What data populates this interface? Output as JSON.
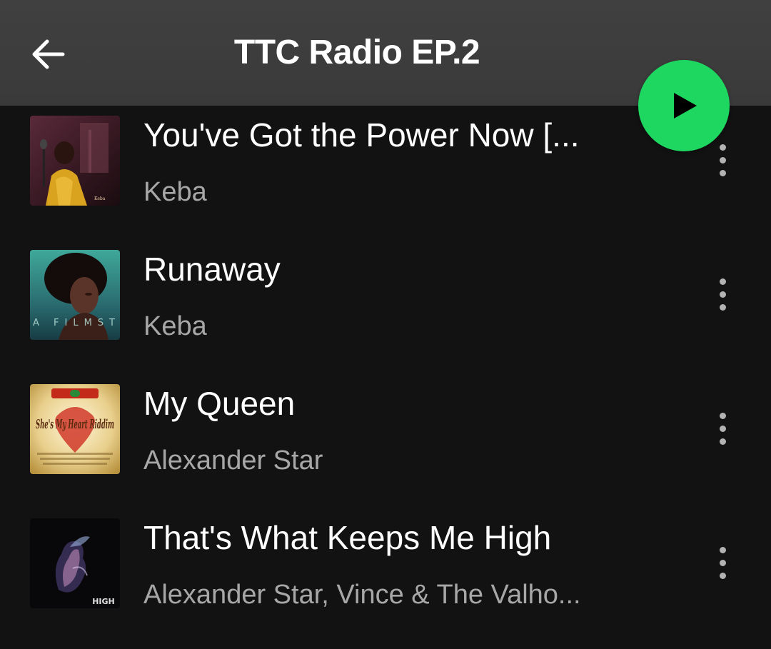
{
  "header": {
    "title": "TTC Radio EP.2",
    "back_icon": "arrow-left-icon",
    "play_icon": "play-icon",
    "play_color": "#1ed760"
  },
  "tracks": [
    {
      "title": "You've Got the Power Now [...",
      "artist": "Keba",
      "art_icon": "album-art-keba-power"
    },
    {
      "title": "Runaway",
      "artist": "Keba",
      "art_icon": "album-art-keba-filmstrip",
      "art_text": "KEBA FILMSTRIP"
    },
    {
      "title": "My Queen",
      "artist": "Alexander Star",
      "art_icon": "album-art-shes-my-heart-riddim",
      "art_text": "She's My Heart Riddim"
    },
    {
      "title": "That's What Keeps Me High",
      "artist": "Alexander Star, Vince & The Valho...",
      "art_icon": "album-art-keeps-me-high",
      "art_text": "HIGH"
    }
  ]
}
